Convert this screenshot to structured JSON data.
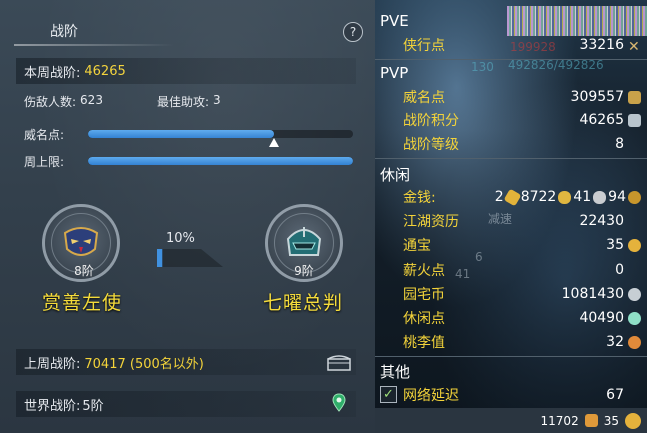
{
  "left": {
    "title": "战阶",
    "help_label": "?",
    "weekly_rank_label": "本周战阶:",
    "weekly_rank_value": "46265",
    "kills_label": "伤敌人数:",
    "kills_value": "623",
    "assist_label": "最佳助攻:",
    "assist_value": "3",
    "prestige_label": "威名点:",
    "prestige_progress": 0.7,
    "weekly_cap_label": "周上限:",
    "weekly_cap_progress": 1.0,
    "current_rank": {
      "level": "8阶",
      "name": "赏善左使"
    },
    "next_rank": {
      "level": "9阶",
      "name": "七曜总判"
    },
    "progress_percent": "10%",
    "progress_value": 0.1,
    "last_week_label": "上周战阶:",
    "last_week_value": "70417 (500名以外)",
    "world_rank_label": "世界战阶:",
    "world_rank_value": "5阶"
  },
  "right": {
    "pve": {
      "title": "PVE",
      "items": [
        {
          "label": "侠行点",
          "value": "33216"
        }
      ]
    },
    "pvp": {
      "title": "PVP",
      "items": [
        {
          "label": "威名点",
          "value": "309557"
        },
        {
          "label": "战阶积分",
          "value": "46265"
        },
        {
          "label": "战阶等级",
          "value": "8"
        }
      ]
    },
    "leisure": {
      "title": "休闲",
      "money_label": "金钱:",
      "money_gold": "2",
      "money_silver1": "8722",
      "money_silver2": "41",
      "money_copper": "94",
      "items": [
        {
          "label": "江湖资历",
          "value": "22430"
        },
        {
          "label": "通宝",
          "value": "35"
        },
        {
          "label": "薪火点",
          "value": "0"
        },
        {
          "label": "园宅币",
          "value": "1081430"
        },
        {
          "label": "休闲点",
          "value": "40490"
        },
        {
          "label": "桃李值",
          "value": "32"
        }
      ]
    },
    "other": {
      "title": "其他",
      "network_label": "网络延迟",
      "network_value": "67"
    },
    "ghost_texts": {
      "hp_a": "199928",
      "hp_b": "492826/492826",
      "lvl": "130",
      "slow": "减速",
      "num41": "41",
      "num6": "6"
    },
    "footer": {
      "value_a": "11702",
      "value_b": "35"
    },
    "colors": {
      "accent_yellow": "#f3d33a",
      "bar_blue": "#3d8fe0"
    }
  }
}
